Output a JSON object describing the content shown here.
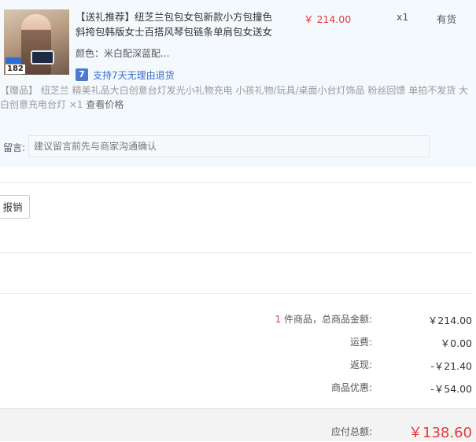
{
  "item": {
    "title": "【送礼推荐】纽芝兰包包女包新款小方包撞色斜挎包韩版女士百搭风琴包链条单肩包女送女",
    "price": "￥ 214.00",
    "qty": "x1",
    "stock": "有货",
    "color": "颜色：米白配深蓝配...",
    "thumb_tag": "182",
    "return_badge": "7",
    "return_text": "支持7天无理由退货"
  },
  "gift": {
    "label": "【赠品】",
    "name": "纽芝兰 精美礼品大白创意台灯发光小礼物充电 小孩礼物/玩具/桌面小台灯饰品 粉丝回馈 单拍不发货 大白创意充电台灯",
    "qty": "×1",
    "view_price": "查看价格"
  },
  "message": {
    "label": "留言:",
    "placeholder": "建议留言前先与商家沟通确认"
  },
  "reimburse_label": "报销",
  "summary": {
    "count": "1",
    "goods_label": "件商品，总商品金额:",
    "goods_value": "￥214.00",
    "shipping_label": "运费:",
    "shipping_value": "￥0.00",
    "cashback_label": "返现:",
    "cashback_value": "-￥21.40",
    "discount_label": "商品优惠:",
    "discount_value": "-￥54.00",
    "payable_label": "应付总额:",
    "payable_value": "￥138.60"
  }
}
